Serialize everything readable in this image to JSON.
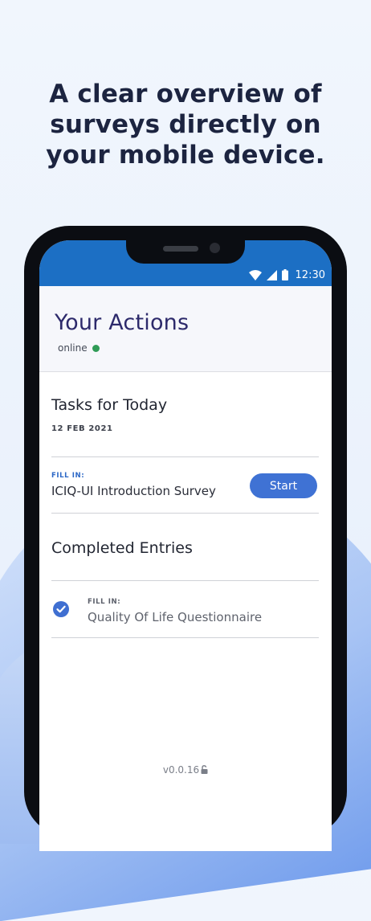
{
  "promo": {
    "headline_line1": "A clear overview of",
    "headline_line2": "surveys directly on",
    "headline_line3": "your mobile device."
  },
  "statusbar": {
    "time": "12:30",
    "icons": [
      "wifi-icon",
      "signal-icon",
      "battery-icon"
    ]
  },
  "header": {
    "title": "Your Actions",
    "connection_status": "online",
    "status_color": "#2f9b56"
  },
  "tasks": {
    "title": "Tasks for Today",
    "date": "12 FEB 2021",
    "items": [
      {
        "tag": "FILL IN:",
        "name": "ICIQ-UI Introduction Survey",
        "action_label": "Start"
      }
    ]
  },
  "completed": {
    "title": "Completed Entries",
    "items": [
      {
        "tag": "FILL IN:",
        "name": "Quality Of Life Questionnaire",
        "icon": "check-circle-icon"
      }
    ]
  },
  "footer": {
    "version": "v0.0.16",
    "icon": "unlock-icon"
  },
  "colors": {
    "appbar": "#1c6fc4",
    "accent": "#3f72d4",
    "title": "#2d2a6b"
  }
}
